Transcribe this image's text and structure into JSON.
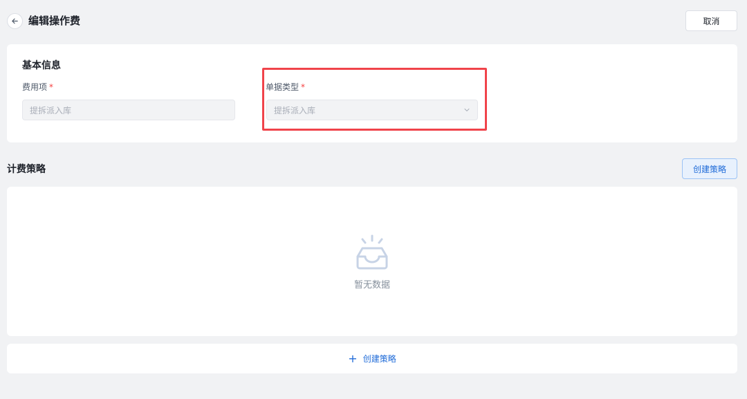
{
  "header": {
    "title": "编辑操作费",
    "cancel_label": "取消"
  },
  "basic_info": {
    "section_title": "基本信息",
    "fee_item": {
      "label": "费用项",
      "required_mark": "*",
      "value": "提拆派入库"
    },
    "doc_type": {
      "label": "单据类型",
      "required_mark": "*",
      "value": "提拆派入库"
    }
  },
  "billing": {
    "section_title": "计费策略",
    "create_button_label": "创建策略",
    "empty_text": "暂无数据",
    "add_button_icon": "+",
    "add_button_label": "创建策略"
  },
  "colors": {
    "accent": "#1f6bd8",
    "required": "#f53f3f",
    "highlight": "#f0434a"
  },
  "icons": [
    "back-arrow-icon",
    "chevron-down-icon",
    "empty-inbox-icon",
    "plus-icon"
  ]
}
